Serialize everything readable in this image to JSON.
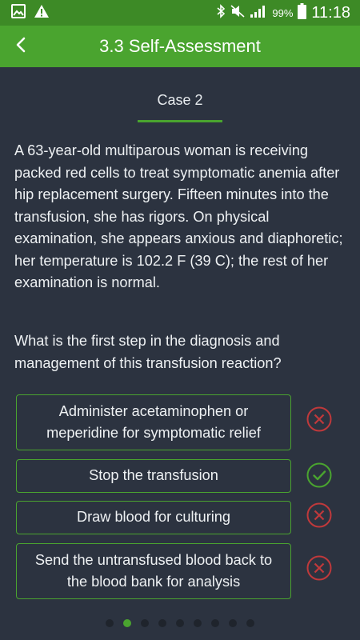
{
  "status_bar": {
    "battery_percent": "99%",
    "time": "11:18",
    "icons": [
      "gallery-icon",
      "warning-icon",
      "bluetooth-icon",
      "mute-icon",
      "signal-icon",
      "battery-icon"
    ]
  },
  "app_bar": {
    "title": "3.3 Self-Assessment",
    "back_icon": "chevron-left-icon"
  },
  "case": {
    "title": "Case 2",
    "text": "A 63-year-old multiparous woman is receiving packed red cells to treat symptomatic anemia after hip replacement surgery. Fifteen minutes into the transfusion, she has rigors. On physical examination, she appears anxious and diaphoretic; her temperature is 102.2 F (39 C); the rest of her examination is normal."
  },
  "question": "What is the first step in the diagnosis and management of this transfusion reaction?",
  "options": [
    {
      "label": "Administer acetaminophen or meperidine for symptomatic relief",
      "status": "incorrect"
    },
    {
      "label": "Stop the transfusion",
      "status": "correct"
    },
    {
      "label": "Draw blood for culturing",
      "status": "incorrect"
    },
    {
      "label": "Send the untransfused blood back to the blood bank for analysis",
      "status": "incorrect"
    }
  ],
  "pager": {
    "total": 9,
    "active": 2
  },
  "colors": {
    "accent": "#4aa42f",
    "status_bar": "#3d8a26",
    "background": "#2c3340",
    "incorrect": "#c0393b",
    "correct": "#4aa42f"
  }
}
